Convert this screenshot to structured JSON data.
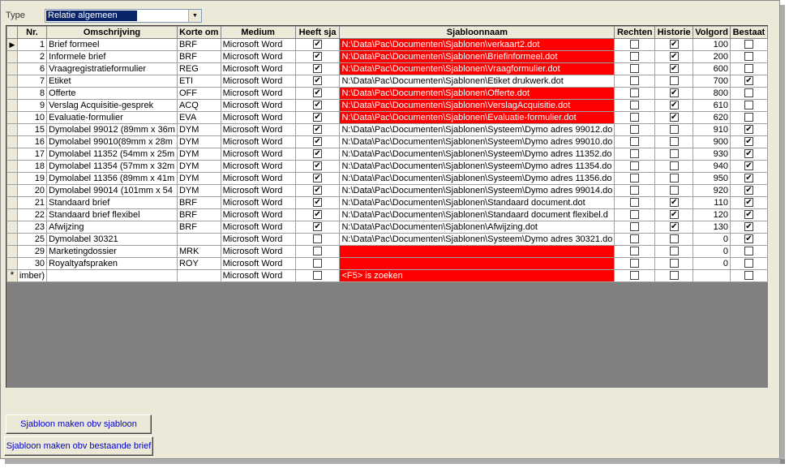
{
  "form": {
    "type_label": "Type",
    "type_value": "Relatie algemeen"
  },
  "columns": [
    "Nr.",
    "Omschrijving",
    "Korte om",
    "Medium",
    "Heeft sja",
    "Sjabloonnaam",
    "Rechten",
    "Historie",
    "Volgord",
    "Bestaat"
  ],
  "rows": [
    {
      "nr": "1",
      "omschrijving": "Brief formeel",
      "kort": "BRF",
      "medium": "Microsoft Word",
      "heeft": true,
      "naam": "N:\\Data\\Pac\\Documenten\\Sjablonen\\verkaart2.dot",
      "red": true,
      "rechten": false,
      "historie": true,
      "volgorde": "100",
      "bestaat": false,
      "current": true
    },
    {
      "nr": "2",
      "omschrijving": "Informele brief",
      "kort": "BRF",
      "medium": "Microsoft Word",
      "heeft": true,
      "naam": "N:\\Data\\Pac\\Documenten\\Sjablonen\\Briefinformeel.dot",
      "red": true,
      "rechten": false,
      "historie": true,
      "volgorde": "200",
      "bestaat": false
    },
    {
      "nr": "6",
      "omschrijving": "Vraagregistratieformulier",
      "kort": "REG",
      "medium": "Microsoft Word",
      "heeft": true,
      "naam": "N:\\Data\\Pac\\Documenten\\Sjablonen\\Vraagformulier.dot",
      "red": true,
      "rechten": false,
      "historie": true,
      "volgorde": "600",
      "bestaat": false
    },
    {
      "nr": "7",
      "omschrijving": "Etiket",
      "kort": "ETI",
      "medium": "Microsoft Word",
      "heeft": true,
      "naam": "N:\\Data\\Pac\\Documenten\\Sjablonen\\Etiket drukwerk.dot",
      "red": false,
      "rechten": false,
      "historie": false,
      "volgorde": "700",
      "bestaat": true
    },
    {
      "nr": "8",
      "omschrijving": "Offerte",
      "kort": "OFF",
      "medium": "Microsoft Word",
      "heeft": true,
      "naam": "N:\\Data\\Pac\\Documenten\\Sjablonen\\Offerte.dot",
      "red": true,
      "rechten": false,
      "historie": true,
      "volgorde": "800",
      "bestaat": false
    },
    {
      "nr": "9",
      "omschrijving": "Verslag Acquisitie-gesprek",
      "kort": "ACQ",
      "medium": "Microsoft Word",
      "heeft": true,
      "naam": "N:\\Data\\Pac\\Documenten\\Sjablonen\\VerslagAcquisitie.dot",
      "red": true,
      "rechten": false,
      "historie": true,
      "volgorde": "610",
      "bestaat": false
    },
    {
      "nr": "10",
      "omschrijving": "Evaluatie-formulier",
      "kort": "EVA",
      "medium": "Microsoft Word",
      "heeft": true,
      "naam": "N:\\Data\\Pac\\Documenten\\Sjablonen\\Evaluatie-formulier.dot",
      "red": true,
      "rechten": false,
      "historie": true,
      "volgorde": "620",
      "bestaat": false
    },
    {
      "nr": "15",
      "omschrijving": "Dymolabel 99012 (89mm x 36m",
      "kort": "DYM",
      "medium": "Microsoft Word",
      "heeft": true,
      "naam": "N:\\Data\\Pac\\Documenten\\Sjablonen\\Systeem\\Dymo adres 99012.do",
      "red": false,
      "rechten": false,
      "historie": false,
      "volgorde": "910",
      "bestaat": true
    },
    {
      "nr": "16",
      "omschrijving": "Dymolabel  99010(89mm x 28m",
      "kort": "DYM",
      "medium": "Microsoft Word",
      "heeft": true,
      "naam": "N:\\Data\\Pac\\Documenten\\Sjablonen\\Systeem\\Dymo adres 99010.do",
      "red": false,
      "rechten": false,
      "historie": false,
      "volgorde": "900",
      "bestaat": true
    },
    {
      "nr": "17",
      "omschrijving": "Dymolabel 11352 (54mm x 25m",
      "kort": "DYM",
      "medium": "Microsoft Word",
      "heeft": true,
      "naam": "N:\\Data\\Pac\\Documenten\\Sjablonen\\Systeem\\Dymo adres 11352.do",
      "red": false,
      "rechten": false,
      "historie": false,
      "volgorde": "930",
      "bestaat": true
    },
    {
      "nr": "18",
      "omschrijving": "Dymolabel 11354 (57mm x 32m",
      "kort": "DYM",
      "medium": "Microsoft Word",
      "heeft": true,
      "naam": "N:\\Data\\Pac\\Documenten\\Sjablonen\\Systeem\\Dymo adres 11354.do",
      "red": false,
      "rechten": false,
      "historie": false,
      "volgorde": "940",
      "bestaat": true
    },
    {
      "nr": "19",
      "omschrijving": "Dymolabel 11356 (89mm x 41m",
      "kort": "DYM",
      "medium": "Microsoft Word",
      "heeft": true,
      "naam": "N:\\Data\\Pac\\Documenten\\Sjablonen\\Systeem\\Dymo adres 11356.do",
      "red": false,
      "rechten": false,
      "historie": false,
      "volgorde": "950",
      "bestaat": true
    },
    {
      "nr": "20",
      "omschrijving": "Dymolabel 99014 (101mm x 54",
      "kort": "DYM",
      "medium": "Microsoft Word",
      "heeft": true,
      "naam": "N:\\Data\\Pac\\Documenten\\Sjablonen\\Systeem\\Dymo adres 99014.do",
      "red": false,
      "rechten": false,
      "historie": false,
      "volgorde": "920",
      "bestaat": true
    },
    {
      "nr": "21",
      "omschrijving": "Standaard brief",
      "kort": "BRF",
      "medium": "Microsoft Word",
      "heeft": true,
      "naam": "N:\\Data\\Pac\\Documenten\\Sjablonen\\Standaard document.dot",
      "red": false,
      "rechten": false,
      "historie": true,
      "volgorde": "110",
      "bestaat": true
    },
    {
      "nr": "22",
      "omschrijving": "Standaard brief flexibel",
      "kort": "BRF",
      "medium": "Microsoft Word",
      "heeft": true,
      "naam": "N:\\Data\\Pac\\Documenten\\Sjablonen\\Standaard document flexibel.d",
      "red": false,
      "rechten": false,
      "historie": true,
      "volgorde": "120",
      "bestaat": true
    },
    {
      "nr": "23",
      "omschrijving": "Afwijzing",
      "kort": "BRF",
      "medium": "Microsoft Word",
      "heeft": true,
      "naam": "N:\\Data\\Pac\\Documenten\\Sjablonen\\Afwijzing.dot",
      "red": false,
      "rechten": false,
      "historie": true,
      "volgorde": "130",
      "bestaat": true
    },
    {
      "nr": "25",
      "omschrijving": "Dymolabel  30321",
      "kort": "",
      "medium": "Microsoft Word",
      "heeft": false,
      "naam": "N:\\Data\\Pac\\Documenten\\Sjablonen\\Systeem\\Dymo adres 30321.do",
      "red": false,
      "rechten": false,
      "historie": false,
      "volgorde": "0",
      "bestaat": true
    },
    {
      "nr": "29",
      "omschrijving": "Marketingdossier",
      "kort": "MRK",
      "medium": "Microsoft Word",
      "heeft": false,
      "naam": "",
      "red": true,
      "rechten": false,
      "historie": false,
      "volgorde": "0",
      "bestaat": false
    },
    {
      "nr": "30",
      "omschrijving": "Royaltyafspraken",
      "kort": "ROY",
      "medium": "Microsoft Word",
      "heeft": false,
      "naam": "",
      "red": true,
      "rechten": false,
      "historie": false,
      "volgorde": "0",
      "bestaat": false
    }
  ],
  "new_row": {
    "marker": "*",
    "nr": "imber)",
    "medium": "Microsoft Word",
    "naam": "<F5> is zoeken"
  },
  "buttons": {
    "from_template": "Sjabloon maken obv sjabloon",
    "from_letter": "Sjabloon maken obv bestaande brief"
  },
  "icons": {
    "current_row": "row-pointer-icon",
    "new_row": "new-record-icon",
    "dropdown": "chevron-down-icon"
  }
}
